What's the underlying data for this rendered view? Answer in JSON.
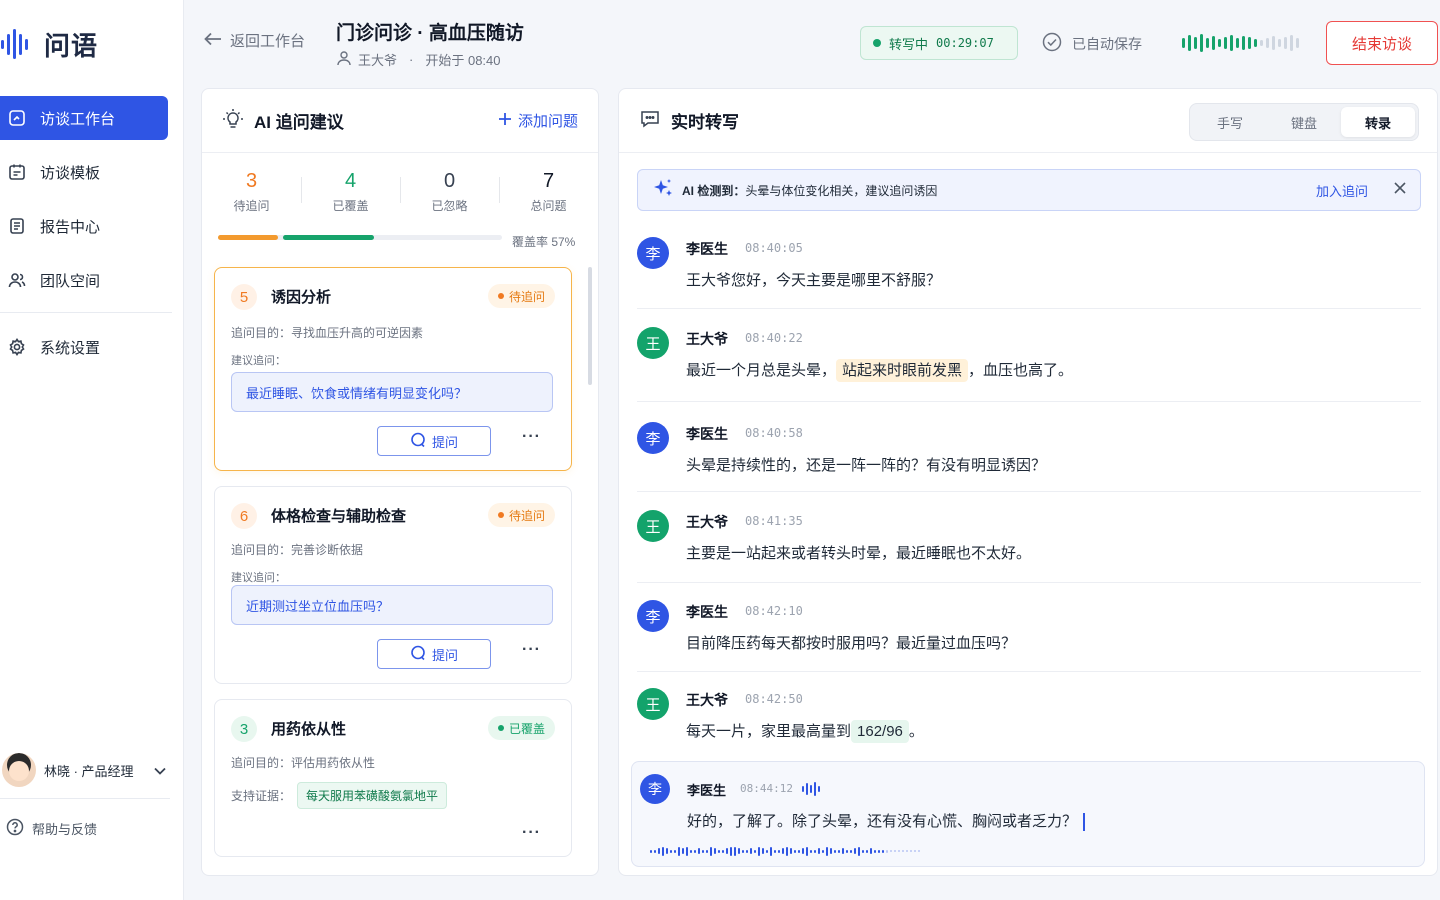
{
  "app": {
    "name": "问语"
  },
  "sidebar": {
    "items": [
      {
        "label": "访谈工作台",
        "icon": "workbench-icon",
        "active": true
      },
      {
        "label": "访谈模板",
        "icon": "template-icon",
        "active": false
      },
      {
        "label": "报告中心",
        "icon": "report-icon",
        "active": false
      },
      {
        "label": "团队空间",
        "icon": "team-icon",
        "active": false
      },
      {
        "label": "系统设置",
        "icon": "settings-icon",
        "active": false
      }
    ],
    "user": "林晓 · 产品经理",
    "help": "帮助与反馈"
  },
  "header": {
    "back": "返回工作台",
    "title": "门诊问诊 · 高血压随访",
    "patient": "王大爷",
    "separator": "·",
    "started": "开始于 08:40",
    "status_label": "转写中",
    "status_time": "00:29:07",
    "autosave": "已自动保存",
    "end_button": "结束访谈"
  },
  "left_panel": {
    "title": "AI 追问建议",
    "add_label": "添加问题",
    "stats": [
      {
        "value": "3",
        "label": "待追问",
        "color": "#f07a22"
      },
      {
        "value": "4",
        "label": "已覆盖",
        "color": "#16a36b"
      },
      {
        "value": "0",
        "label": "已忽略",
        "color": "#374151"
      },
      {
        "value": "7",
        "label": "总问题",
        "color": "#111827"
      }
    ],
    "progress": {
      "pending_fraction": 0.21,
      "covered_fraction": 0.32
    },
    "coverage": "覆盖率 57%",
    "cards": [
      {
        "number": "5",
        "title": "诱因分析",
        "status": "待追问",
        "purpose": "追问目的：寻找血压升高的可逆因素",
        "suggest_label": "建议追问：",
        "suggest": "最近睡眠、饮食或情绪有明显变化吗？",
        "ask": "提问",
        "more": "···"
      },
      {
        "number": "6",
        "title": "体格检查与辅助检查",
        "status": "待追问",
        "purpose": "追问目的：完善诊断依据",
        "suggest_label": "建议追问：",
        "suggest": "近期测过坐立位血压吗？",
        "ask": "提问",
        "more": "···"
      },
      {
        "number": "3",
        "title": "用药依从性",
        "status": "已覆盖",
        "purpose": "追问目的：评估用药依从性",
        "evidence_label": "支持证据：",
        "evidence": "每天服用苯磺酸氨氯地平",
        "more": "···"
      }
    ]
  },
  "right_panel": {
    "title": "实时转写",
    "tabs": [
      "手写",
      "键盘",
      "转录"
    ],
    "active_tab": "转录",
    "alert": {
      "prefix": "AI 检测到：",
      "text": "头晕与体位变化相关，建议追问诱因",
      "action": "加入追问"
    },
    "messages": [
      {
        "avatar": "李",
        "name": "李医生",
        "time": "08:40:05",
        "text": "王大爷您好，今天主要是哪里不舒服？"
      },
      {
        "avatar": "王",
        "name": "王大爷",
        "time": "08:40:22",
        "before": "最近一个月总是头晕，",
        "highlight": "站起来时眼前发黑",
        "after": "，血压也高了。"
      },
      {
        "avatar": "李",
        "name": "李医生",
        "time": "08:40:58",
        "text": "头晕是持续性的，还是一阵一阵的？有没有明显诱因？"
      },
      {
        "avatar": "王",
        "name": "王大爷",
        "time": "08:41:35",
        "text": "主要是一站起来或者转头时晕，最近睡眠也不太好。"
      },
      {
        "avatar": "李",
        "name": "李医生",
        "time": "08:42:10",
        "text": "目前降压药每天都按时服用吗？最近量过血压吗？"
      },
      {
        "avatar": "王",
        "name": "王大爷",
        "time": "08:42:50",
        "before": "每天一片，家里最高量到",
        "highlight": "162/96",
        "after": "。"
      },
      {
        "avatar": "李",
        "name": "李医生",
        "time": "08:44:12",
        "text": "好的，了解了。除了头晕，还有没有心慌、胸闷或者乏力？"
      }
    ]
  },
  "colors": {
    "primary": "#2f55e4",
    "success": "#16a36b",
    "warning": "#f07a22",
    "danger": "#e53935"
  }
}
